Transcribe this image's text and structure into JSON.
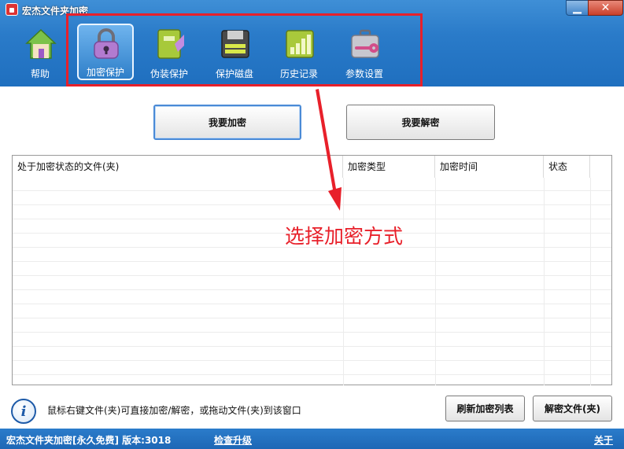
{
  "window": {
    "title": "宏杰文件夹加密"
  },
  "toolbar": {
    "items": [
      {
        "label": "帮助",
        "icon": "house-icon"
      },
      {
        "label": "加密保护",
        "icon": "padlock-icon",
        "active": true
      },
      {
        "label": "伪装保护",
        "icon": "notebook-icon"
      },
      {
        "label": "保护磁盘",
        "icon": "floppy-disk-icon"
      },
      {
        "label": "历史记录",
        "icon": "bar-chart-icon"
      },
      {
        "label": "参数设置",
        "icon": "toolbox-icon"
      }
    ]
  },
  "actions": {
    "encrypt_label": "我要加密",
    "decrypt_label": "我要解密"
  },
  "table": {
    "columns": [
      "处于加密状态的文件(夹)",
      "加密类型",
      "加密时间",
      "状态"
    ],
    "rows": []
  },
  "annotation": {
    "text": "选择加密方式"
  },
  "footer": {
    "hint": "鼠标右键文件(夹)可直接加密/解密，或拖动文件(夹)到该窗口",
    "refresh_label": "刷新加密列表",
    "decrypt_file_label": "解密文件(夹)"
  },
  "statusbar": {
    "app_info": "宏杰文件夹加密[永久免费]  版本:3018",
    "check_update": "检查升级",
    "about": "关于"
  },
  "colors": {
    "accent_blue": "#2a7bc9",
    "annotation_red": "#e8202a"
  }
}
